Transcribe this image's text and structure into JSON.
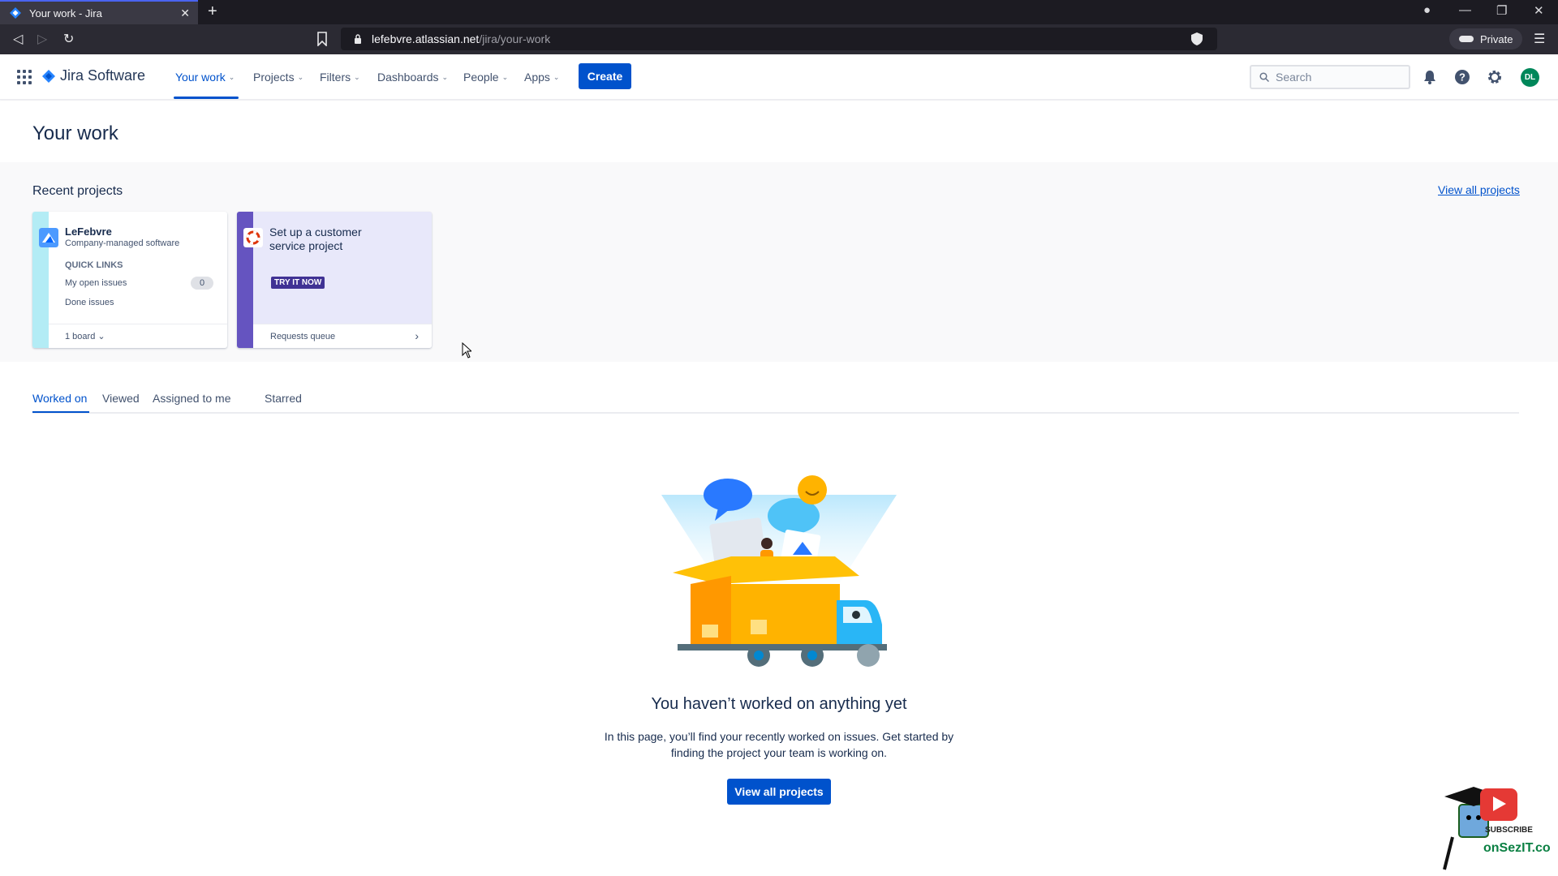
{
  "browser": {
    "tab_title": "Your work - Jira",
    "url_host": "lefebvre.atlassian.net",
    "url_path": "/jira/your-work",
    "private_label": "Private"
  },
  "topnav": {
    "product_name": "Jira Software",
    "items": [
      {
        "label": "Your work"
      },
      {
        "label": "Projects"
      },
      {
        "label": "Filters"
      },
      {
        "label": "Dashboards"
      },
      {
        "label": "People"
      },
      {
        "label": "Apps"
      }
    ],
    "create_label": "Create",
    "search_placeholder": "Search",
    "avatar_initials": "DL"
  },
  "page": {
    "title": "Your work"
  },
  "recent_projects": {
    "title": "Recent projects",
    "view_all_label": "View all projects",
    "project_card": {
      "name": "LeFebvre",
      "type": "Company-managed software",
      "quick_links_label": "QUICK LINKS",
      "links": [
        {
          "label": "My open issues",
          "count": "0"
        },
        {
          "label": "Done issues"
        }
      ],
      "board_label": "1 board"
    },
    "promo_card": {
      "title": "Set up a customer service project",
      "cta": "TRY IT NOW",
      "footer_label": "Requests queue"
    }
  },
  "work_tabs": [
    {
      "label": "Worked on"
    },
    {
      "label": "Viewed"
    },
    {
      "label": "Assigned to me"
    },
    {
      "label": "Starred"
    }
  ],
  "empty_state": {
    "title": "You haven’t worked on anything yet",
    "description": "In this page, you’ll find your recently worked on issues. Get started by finding the project your team is working on.",
    "button_label": "View all projects"
  },
  "watermark": {
    "text": "onSezIT.com",
    "badge": "SUBSCRIBE"
  },
  "colors": {
    "brand": "#0052cc",
    "promo_accent": "#6554c0",
    "project_stripe": "#b3ecf5"
  }
}
